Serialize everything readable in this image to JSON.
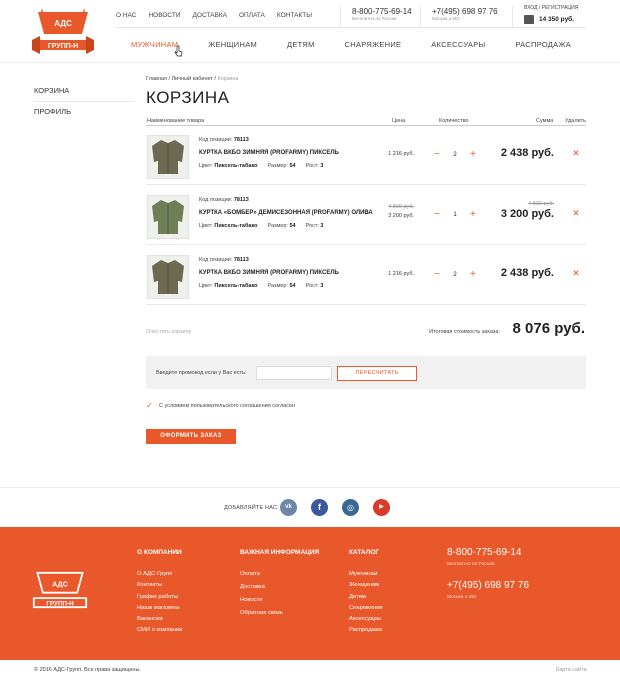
{
  "brand": {
    "logo_text": "АДС · ГРУПП-Н",
    "accent": "#e8582a"
  },
  "top_nav": [
    "О НАС",
    "НОВОСТИ",
    "ДОСТАВКА",
    "ОПЛАТА",
    "КОНТАКТЫ"
  ],
  "phones": [
    {
      "number": "8-800-775-69-14",
      "note": "Бесплатно по России"
    },
    {
      "number": "+7(495) 698 97 76",
      "note": "Москва и МО"
    }
  ],
  "account": {
    "login": "ВХОД / РЕГИСТРАЦИЯ",
    "cart_total": "14 350 руб."
  },
  "main_nav": [
    "МУЖЧИНАМ",
    "ЖЕНЩИНАМ",
    "ДЕТЯМ",
    "СНАРЯЖЕНИЕ",
    "АКСЕССУАРЫ",
    "РАСПРОДАЖА"
  ],
  "sidebar": [
    "КОРЗИНА",
    "ПРОФИЛЬ"
  ],
  "breadcrumbs": [
    "Главная",
    "Личный кабинет",
    "Корзина"
  ],
  "page_title": "КОРЗИНА",
  "table_headers": {
    "name": "Наименование товара",
    "price": "Цена",
    "qty": "Количество",
    "sum": "Сумма",
    "delete": "Удалить"
  },
  "labels": {
    "code": "Код позиции:",
    "color": "Цвет:",
    "size": "Размер:",
    "height": "Рост:"
  },
  "items": [
    {
      "code": "78113",
      "name": "КУРТКА ВКБО ЗИМНЯЯ (PROFARMY) ПИКСЕЛЬ",
      "color": "Пиксель-табако",
      "size": "54",
      "height": "3",
      "price_old": "",
      "price": "1 216 руб.",
      "qty": "2",
      "sum_old": "",
      "sum": "2 438 руб.",
      "thumb_color": "#6e6a52"
    },
    {
      "code": "78113",
      "name": "КУРТКА «БОМБЕР» ДЕМИСЕЗОННАЯ (PROFARMY) ОЛИВА",
      "color": "Пиксель-табако",
      "size": "54",
      "height": "3",
      "price_old": "4 800 руб.",
      "price": "3 200 руб.",
      "qty": "1",
      "sum_old": "4 800 руб.",
      "sum": "3 200 руб.",
      "thumb_color": "#6f7f55"
    },
    {
      "code": "78113",
      "name": "КУРТКА ВКБО ЗИМНЯЯ (PROFARMY) ПИКСЕЛЬ",
      "color": "Пиксель-табако",
      "size": "54",
      "height": "3",
      "price_old": "",
      "price": "1 216 руб.",
      "qty": "2",
      "sum_old": "",
      "sum": "2 438 руб.",
      "thumb_color": "#6e6a52"
    }
  ],
  "clear_cart": "Очистить корзину",
  "total_label": "Итоговая стоимость заказа:",
  "total": "8 076 руб.",
  "promo": {
    "label": "Введите промокод если у Вас есть:",
    "value": "",
    "button": "ПЕРЕСЧИТАТЬ"
  },
  "agree_text": "С условием пользовательского соглашения согласен",
  "order_button": "ОФОРМИТЬ ЗАКАЗ",
  "social": {
    "label": "ДОБАВЛЯЙТЕ НАС",
    "networks": [
      {
        "name": "vk",
        "glyph": "vk",
        "color": "#6e86a8"
      },
      {
        "name": "facebook",
        "glyph": "f",
        "color": "#3b5a9a"
      },
      {
        "name": "instagram",
        "glyph": "◎",
        "color": "#3a6a94"
      },
      {
        "name": "youtube",
        "glyph": "▶",
        "color": "#d93b2b"
      }
    ]
  },
  "footer": {
    "col1": {
      "title": "О КОМПАНИИ",
      "links": [
        "О АДС-Групп",
        "Контакты",
        "График работы",
        "Наши магазины",
        "Вакансии",
        "СМИ о компании"
      ]
    },
    "col2": {
      "title": "ВАЖНАЯ ИНФОРМАЦИЯ",
      "links": [
        "Оплата",
        "Доставка",
        "Новости",
        "Обратная связь"
      ]
    },
    "col3": {
      "title": "КАТАЛОГ",
      "links": [
        "Мужчинам",
        "Женщинам",
        "Детям",
        "Снаряжение",
        "Аксессуары",
        "Распродажа"
      ]
    },
    "phones": [
      {
        "number": "8-800-775-69-14",
        "note": "Бесплатно по России"
      },
      {
        "number": "+7(495) 698 97 76",
        "note": "Москва и МО"
      }
    ]
  },
  "copyright": "© 2016 АДС-Групп. Все права защищены.",
  "sitemap": "Карта сайта"
}
